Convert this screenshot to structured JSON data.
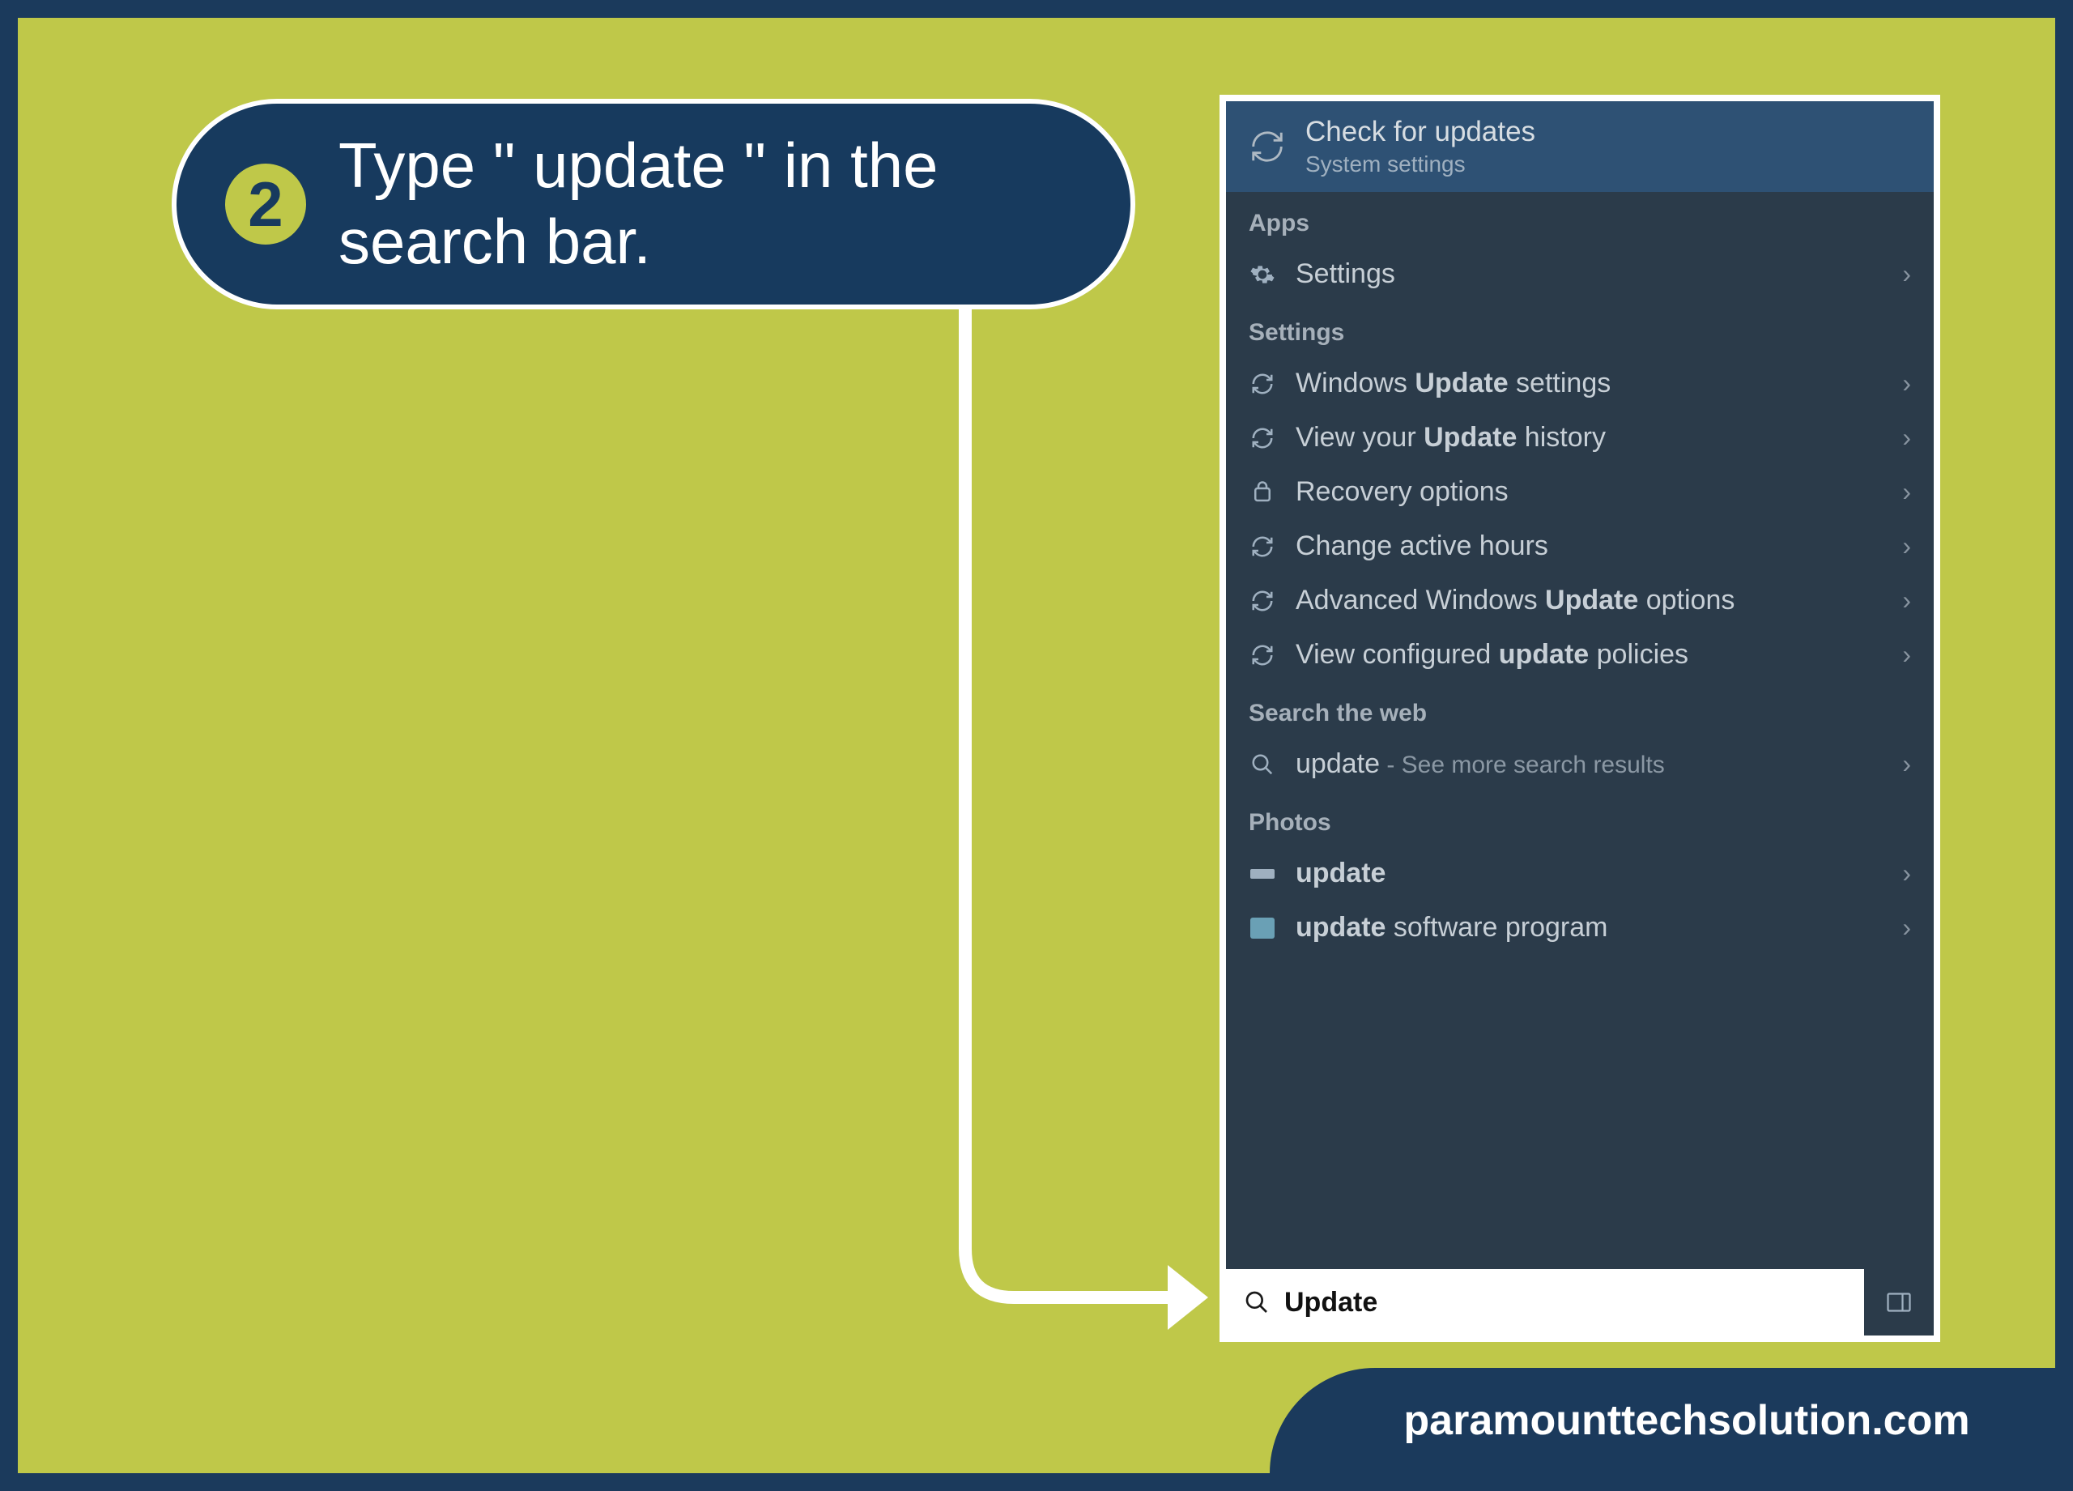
{
  "callout": {
    "step_number": "2",
    "text": "Type \" update \" in the search bar."
  },
  "panel": {
    "best_match": {
      "title": "Check for updates",
      "subtitle": "System settings"
    },
    "sections": {
      "apps_label": "Apps",
      "settings_label": "Settings",
      "web_label": "Search the web",
      "photos_label": "Photos"
    },
    "apps": {
      "settings": "Settings"
    },
    "settings_items": {
      "win_update_pre": "Windows ",
      "win_update_bold": "Update",
      "win_update_post": " settings",
      "view_hist_pre": "View your ",
      "view_hist_bold": "Update",
      "view_hist_post": " history",
      "recovery": "Recovery options",
      "active_hours": "Change active hours",
      "adv_pre": "Advanced Windows ",
      "adv_bold": "Update",
      "adv_post": " options",
      "policies_pre": "View configured ",
      "policies_bold": "update",
      "policies_post": " policies"
    },
    "web": {
      "term": "update",
      "suffix": " - See more search results"
    },
    "photos": {
      "item1": "update",
      "item2_bold": "update",
      "item2_post": " software program"
    },
    "search_value": "Update"
  },
  "footer": {
    "text": "paramounttechsolution.com"
  }
}
